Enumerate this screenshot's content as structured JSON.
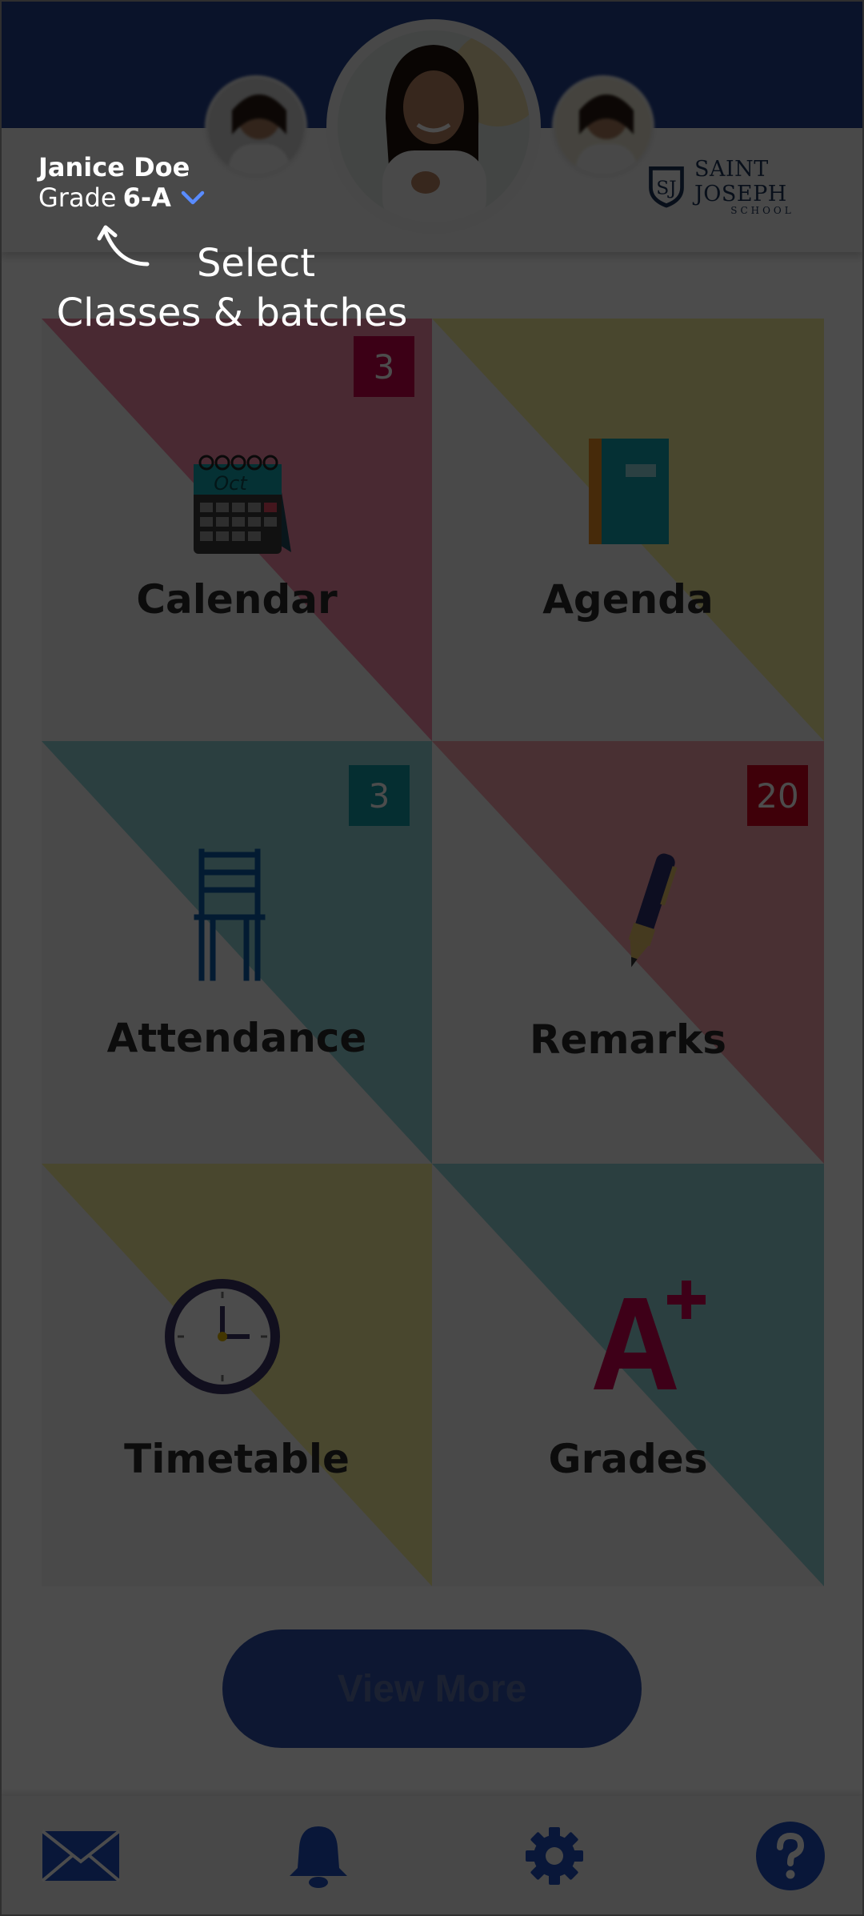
{
  "user": {
    "name": "Janice Doe",
    "grade_prefix": "Grade",
    "grade_value": "6-A"
  },
  "school": {
    "name": "SAINT JOSEPH",
    "sub": "SCHOOL",
    "monogram": "SJ"
  },
  "hint": {
    "line1": "Select",
    "line2": "Classes & batches"
  },
  "tiles": [
    {
      "label": "Calendar",
      "badge": "3",
      "badge_color": "#c9004a",
      "tri_color": "#f48aa7",
      "icon": "calendar-icon",
      "month": "Oct"
    },
    {
      "label": "Agenda",
      "badge": "",
      "badge_color": "",
      "tri_color": "#f4ed9a",
      "icon": "notebook-icon"
    },
    {
      "label": "Attendance",
      "badge": "3",
      "badge_color": "#119aa3",
      "tri_color": "#8fd3d6",
      "icon": "chair-icon"
    },
    {
      "label": "Remarks",
      "badge": "20",
      "badge_color": "#d4001f",
      "tri_color": "#f4a0ac",
      "icon": "pen-icon"
    },
    {
      "label": "Timetable",
      "badge": "",
      "badge_color": "",
      "tri_color": "#f4ed9a",
      "icon": "clock-icon"
    },
    {
      "label": "Grades",
      "badge": "",
      "badge_color": "",
      "tri_color": "#8fd3d6",
      "icon": "grade-a-plus-icon"
    }
  ],
  "view_more": "View More",
  "bottom_nav": [
    "mail-icon",
    "bell-icon",
    "gear-icon",
    "help-icon"
  ],
  "colors": {
    "brand_blue": "#23418e",
    "overlay": "rgba(0,0,0,0.70)"
  }
}
